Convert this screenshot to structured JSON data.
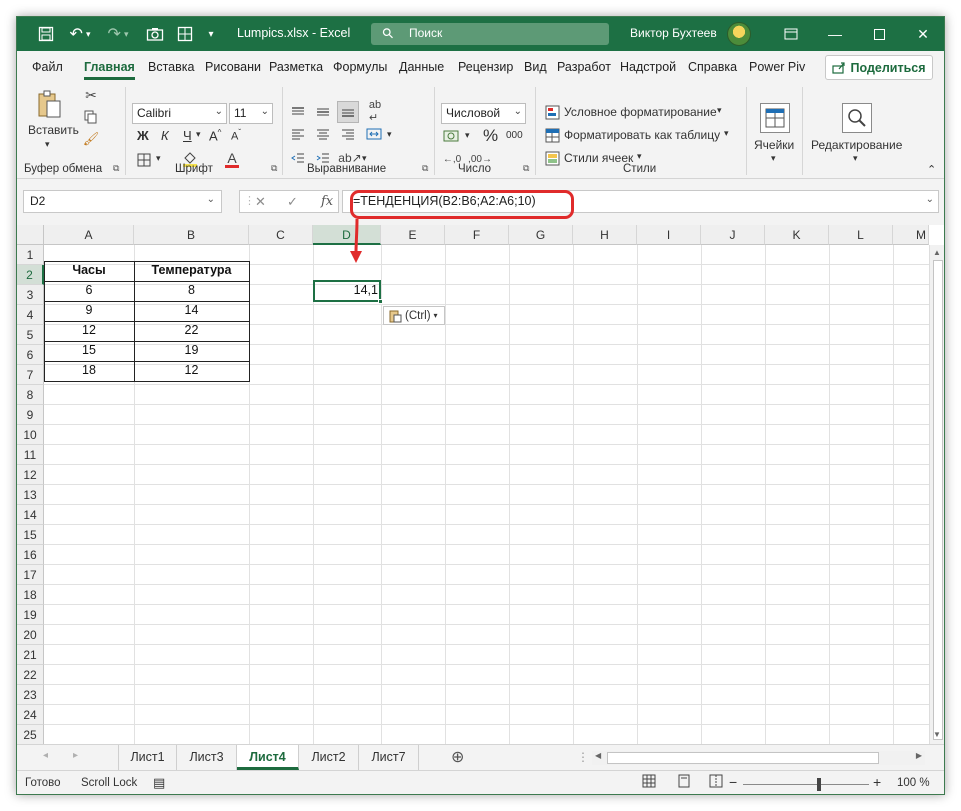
{
  "titlebar": {
    "doc_title": "Lumpics.xlsx  -  Excel",
    "search_placeholder": "Поиск",
    "user_name": "Виктор Бухтеев"
  },
  "tabs": [
    "Файл",
    "Главная",
    "Вставка",
    "Рисовани",
    "Разметка",
    "Формулы",
    "Данные",
    "Рецензир",
    "Вид",
    "Разработ",
    "Надстрой",
    "Справка",
    "Power Piv"
  ],
  "active_tab": "Главная",
  "share_label": "Поделиться",
  "ribbon": {
    "clipboard": {
      "paste_label": "Вставить",
      "group_label": "Буфер обмена"
    },
    "font": {
      "font_name": "Calibri",
      "font_size": "11",
      "bold": "Ж",
      "italic": "К",
      "underline": "Ч",
      "group_label": "Шрифт"
    },
    "alignment": {
      "group_label": "Выравнивание"
    },
    "number": {
      "format": "Числовой",
      "percent": "%",
      "thousands": "000",
      "group_label": "Число"
    },
    "styles": {
      "conditional": "Условное форматирование",
      "as_table": "Форматировать как таблицу",
      "cell_styles": "Стили ячеек",
      "group_label": "Стили"
    },
    "cells": {
      "label": "Ячейки"
    },
    "editing": {
      "label": "Редактирование"
    }
  },
  "formula_bar": {
    "name_box": "D2",
    "formula": "=ТЕНДЕНЦИЯ(B2:B6;A2:A6;10)"
  },
  "columns": [
    "A",
    "B",
    "C",
    "D",
    "E",
    "F",
    "G",
    "H",
    "I",
    "J",
    "K",
    "L",
    "M"
  ],
  "rows": [
    "1",
    "2",
    "3",
    "4",
    "5",
    "6",
    "7",
    "8",
    "9",
    "10",
    "11",
    "12",
    "13",
    "14",
    "15",
    "16",
    "17",
    "18",
    "19",
    "20",
    "21",
    "22",
    "23",
    "24",
    "25"
  ],
  "table": {
    "headers": [
      "Часы",
      "Температура"
    ],
    "data": [
      [
        "6",
        "8"
      ],
      [
        "9",
        "14"
      ],
      [
        "12",
        "22"
      ],
      [
        "15",
        "19"
      ],
      [
        "18",
        "12"
      ]
    ]
  },
  "result_cell": {
    "address": "D2",
    "value": "14,1"
  },
  "paste_options_label": "(Ctrl)",
  "sheets": [
    "Лист1",
    "Лист3",
    "Лист4",
    "Лист2",
    "Лист7"
  ],
  "active_sheet": "Лист4",
  "status": {
    "ready": "Готово",
    "scroll_lock": "Scroll Lock",
    "zoom": "100 %"
  },
  "colors": {
    "accent": "#1d7044",
    "highlight": "#e02b2b"
  }
}
